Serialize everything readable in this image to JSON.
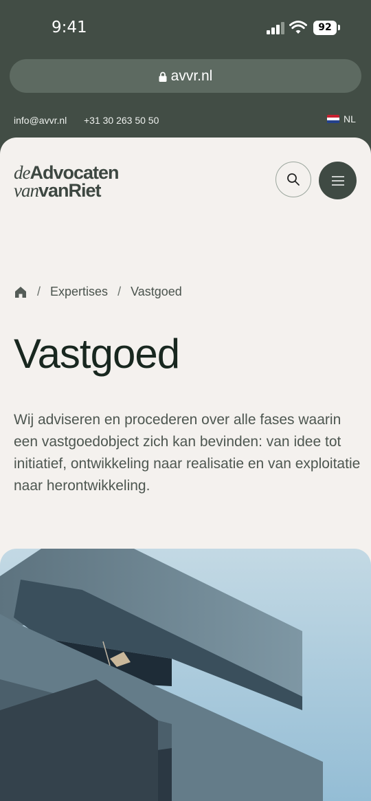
{
  "status_bar": {
    "time": "9:41",
    "battery": "92",
    "icons": [
      "cellular-signal-icon",
      "wifi-icon",
      "battery-icon"
    ]
  },
  "browser": {
    "url": "avvr.nl",
    "icon": "lock-icon"
  },
  "topline": {
    "email": "info@avvr.nl",
    "phone": "+31 30 263 50 50",
    "language": "NL"
  },
  "logo": {
    "line1_italic": "de",
    "line1_bold": "Advocaten",
    "line2_italic": "van",
    "line2_bold": "vanRiet"
  },
  "header": {
    "search_icon": "search-icon",
    "menu_icon": "hamburger-menu-icon"
  },
  "breadcrumb": {
    "home_icon": "home-icon",
    "separator": "/",
    "items": [
      "Expertises",
      "Vastgoed"
    ]
  },
  "page": {
    "title": "Vastgoed",
    "intro": "Wij adviseren en procederen over alle fases waarin een vastgoedobject zich kan bevinden: van idee tot initiatief, ontwikkeling naar realisatie en van exploitatie naar herontwikkeling."
  },
  "colors": {
    "background_dark": "#424d45",
    "card_background": "#f4f1ee",
    "heading": "#18271f",
    "body_text": "#4d5650",
    "menu_button": "#3f4a43"
  }
}
